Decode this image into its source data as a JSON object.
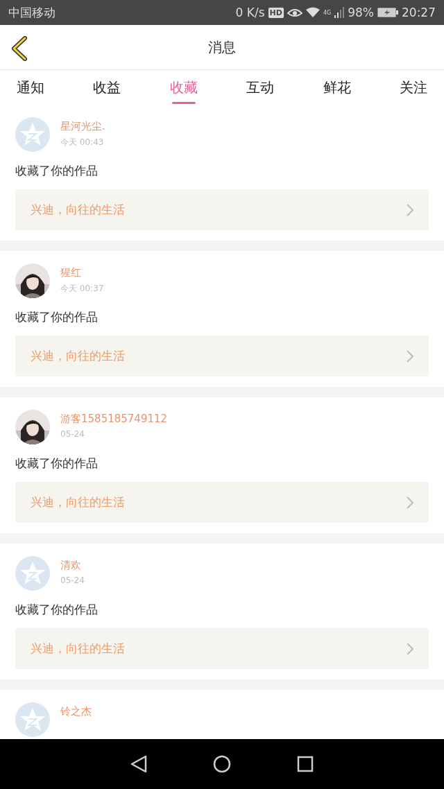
{
  "status_bar": {
    "carrier": "中国移动",
    "speed": "0 K/s",
    "hd": "HD",
    "network": "4G",
    "battery": "98%",
    "time": "20:27"
  },
  "header": {
    "title": "消息"
  },
  "tabs": [
    {
      "label": "通知",
      "selected": false
    },
    {
      "label": "收益",
      "selected": false
    },
    {
      "label": "收藏",
      "selected": true
    },
    {
      "label": "互动",
      "selected": false
    },
    {
      "label": "鲜花",
      "selected": false
    },
    {
      "label": "关注",
      "selected": false
    }
  ],
  "messages": [
    {
      "kind": "default",
      "name": "星河光尘.",
      "time": "今天 00:43",
      "text": "收藏了你的作品",
      "work": "兴迪，向往的生活"
    },
    {
      "kind": "picture",
      "name": "猩红",
      "time": "今天 00:37",
      "text": "收藏了你的作品",
      "work": "兴迪，向往的生活"
    },
    {
      "kind": "picture",
      "name": "游客1585185749112",
      "time": "05-24",
      "text": "收藏了你的作品",
      "work": "兴迪，向往的生活"
    },
    {
      "kind": "default",
      "name": "清欢",
      "time": "05-24",
      "text": "收藏了你的作品",
      "work": "兴迪，向往的生活"
    },
    {
      "kind": "default",
      "name": "铃之杰"
    }
  ]
}
